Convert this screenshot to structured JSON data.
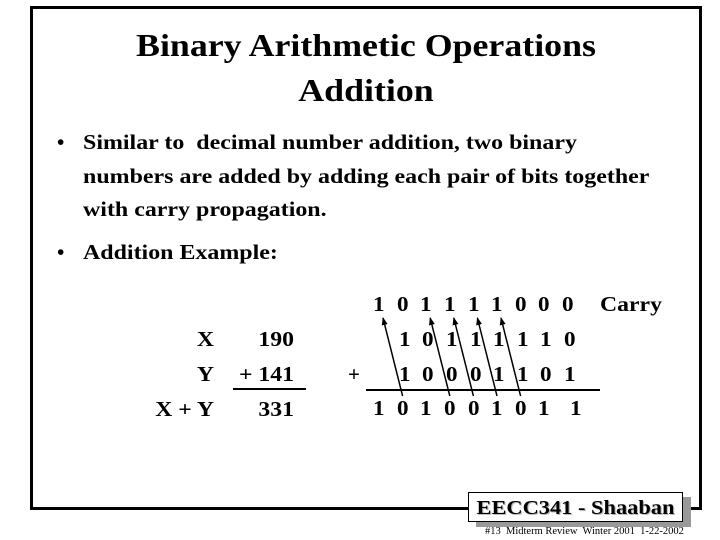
{
  "slide": {
    "title_lines": [
      "Binary Arithmetic Operations",
      "Addition"
    ],
    "bullets": [
      {
        "marker": "•",
        "lines": [
          "Similar to  decimal number addition, two binary",
          "numbers are added by adding each pair of bits together",
          "with carry propagation."
        ]
      },
      {
        "marker": "•",
        "lines": [
          "Addition Example:"
        ]
      }
    ],
    "decimal_example": {
      "rows": [
        {
          "label": "X",
          "value": "190"
        },
        {
          "label": "Y",
          "value": "+ 141"
        },
        {
          "label": "X + Y",
          "value": "331"
        }
      ]
    },
    "binary_example": {
      "carry_label": "Carry",
      "operator": "+",
      "carry_bits": "101111000",
      "x_bits": "10111110",
      "y_bits": "10001101",
      "sum_bits": "101001011",
      "carry_arrows": [
        {
          "from_bit": 7,
          "to_bit": 8
        },
        {
          "from_bit": 5,
          "to_bit": 6
        },
        {
          "from_bit": 4,
          "to_bit": 5
        },
        {
          "from_bit": 3,
          "to_bit": 4
        },
        {
          "from_bit": 2,
          "to_bit": 3
        }
      ]
    },
    "footer": {
      "course_label": "EECC341 - Shaaban",
      "caption": "#13  Midterm Review  Winter 2001  1-22-2002"
    },
    "colors": {
      "text": "#000000",
      "frame": "#000000",
      "footer_shadow": "#999999",
      "background": "#ffffff"
    }
  }
}
